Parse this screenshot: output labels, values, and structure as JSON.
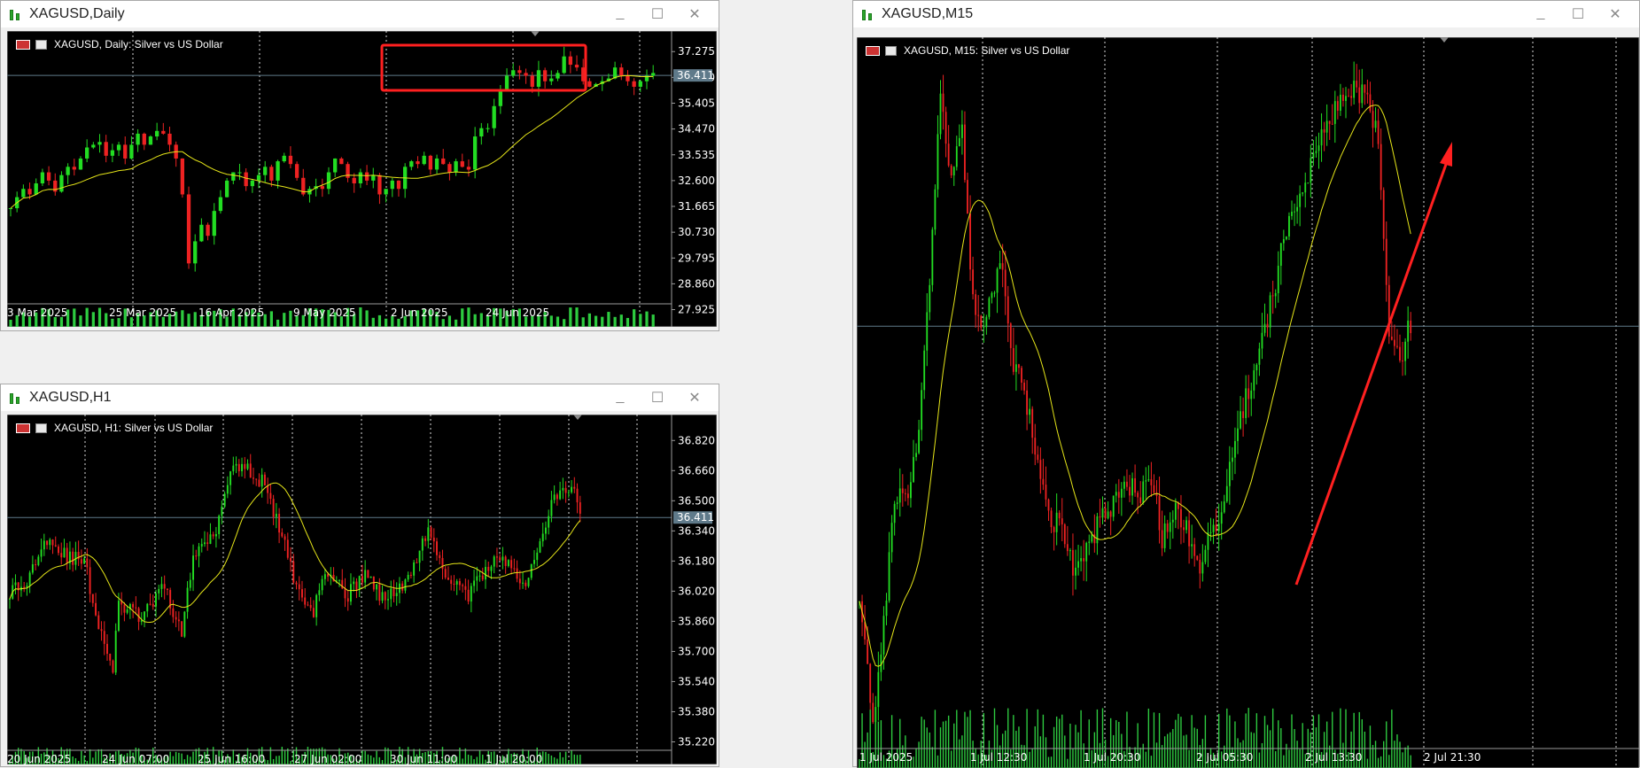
{
  "colors": {
    "up": "#22dd22",
    "down": "#ee2222",
    "ma": "#e6e619",
    "grid": "#ffffff",
    "priceLine": "#5f7a8a",
    "priceTag": "#5f7a8a",
    "box": "#ff2020",
    "arrow": "#ff2020"
  },
  "windows": [
    {
      "title": "XAGUSD,Daily",
      "legend": "XAGUSD, Daily:  Silver vs US Dollar",
      "price_tag": "36.411"
    },
    {
      "title": "XAGUSD,H1",
      "legend": "XAGUSD, H1:  Silver vs US Dollar",
      "price_tag": "36.411"
    },
    {
      "title": "XAGUSD,M15",
      "legend": "XAGUSD, M15:  Silver vs US Dollar",
      "price_tag": ""
    }
  ],
  "window_buttons": {
    "minimize": "_",
    "maximize": "☐",
    "close": "✕"
  },
  "chart_data": [
    {
      "type": "candlestick",
      "title": "XAGUSD, Daily:  Silver vs US Dollar",
      "yticks": [
        37.275,
        36.34,
        35.405,
        34.47,
        33.535,
        32.6,
        31.665,
        30.73,
        29.795,
        28.86,
        27.925
      ],
      "ylim": [
        27.3,
        37.7
      ],
      "xlabels": [
        "3 Mar 2025",
        "25 Mar 2025",
        "16 Apr 2025",
        "9 May 2025",
        "2 Jun 2025",
        "24 Jun 2025"
      ],
      "last_price": 36.411,
      "ma_period": 20,
      "closes": [
        31.6,
        32.0,
        32.3,
        32.1,
        32.5,
        32.9,
        32.6,
        32.2,
        32.8,
        33.1,
        33.0,
        33.4,
        33.8,
        33.9,
        34.0,
        33.5,
        33.7,
        33.9,
        33.4,
        33.9,
        34.3,
        33.9,
        34.2,
        34.4,
        34.3,
        33.9,
        33.4,
        32.1,
        29.6,
        30.4,
        31.0,
        30.6,
        31.5,
        32.0,
        32.6,
        32.9,
        32.9,
        32.4,
        32.6,
        32.8,
        33.1,
        32.6,
        33.3,
        33.5,
        33.2,
        32.7,
        32.1,
        32.3,
        32.4,
        32.3,
        32.9,
        33.4,
        33.2,
        32.7,
        32.5,
        32.9,
        32.6,
        32.8,
        32.1,
        32.3,
        32.6,
        32.3,
        33.1,
        33.3,
        33.2,
        33.5,
        33.0,
        33.4,
        33.2,
        32.9,
        33.3,
        33.1,
        33.0,
        34.2,
        34.5,
        34.5,
        35.3,
        35.9,
        36.4,
        36.6,
        36.5,
        36.4,
        36.0,
        36.6,
        36.2,
        36.3,
        36.5,
        37.1,
        36.8,
        36.7,
        36.2,
        36.0,
        36.1,
        36.2,
        36.3,
        36.7,
        36.4,
        36.2,
        36.0,
        36.2,
        36.4,
        36.5
      ],
      "highlight_range": [
        63,
        90
      ]
    },
    {
      "type": "candlestick",
      "title": "XAGUSD, H1:  Silver vs US Dollar",
      "yticks": [
        36.82,
        36.66,
        36.5,
        36.34,
        36.18,
        36.02,
        35.86,
        35.7,
        35.54,
        35.38,
        35.22
      ],
      "ylim": [
        35.1,
        36.92
      ],
      "xlabels": [
        "20 Jun 2025",
        "24 Jun 07:00",
        "25 Jun 16:00",
        "27 Jun 02:00",
        "30 Jun 11:00",
        "1 Jul 20:00"
      ],
      "last_price": 36.411,
      "ma_period": 20
    },
    {
      "type": "candlestick",
      "title": "XAGUSD, M15:  Silver vs US Dollar",
      "ylim": [
        35.55,
        36.95
      ],
      "xlabels": [
        "1 Jul 2025",
        "1 Jul 12:30",
        "1 Jul 20:30",
        "2 Jul 05:30",
        "2 Jul 13:30",
        "2 Jul 21:30"
      ],
      "last_price": 36.411,
      "ma_period": 20
    }
  ]
}
